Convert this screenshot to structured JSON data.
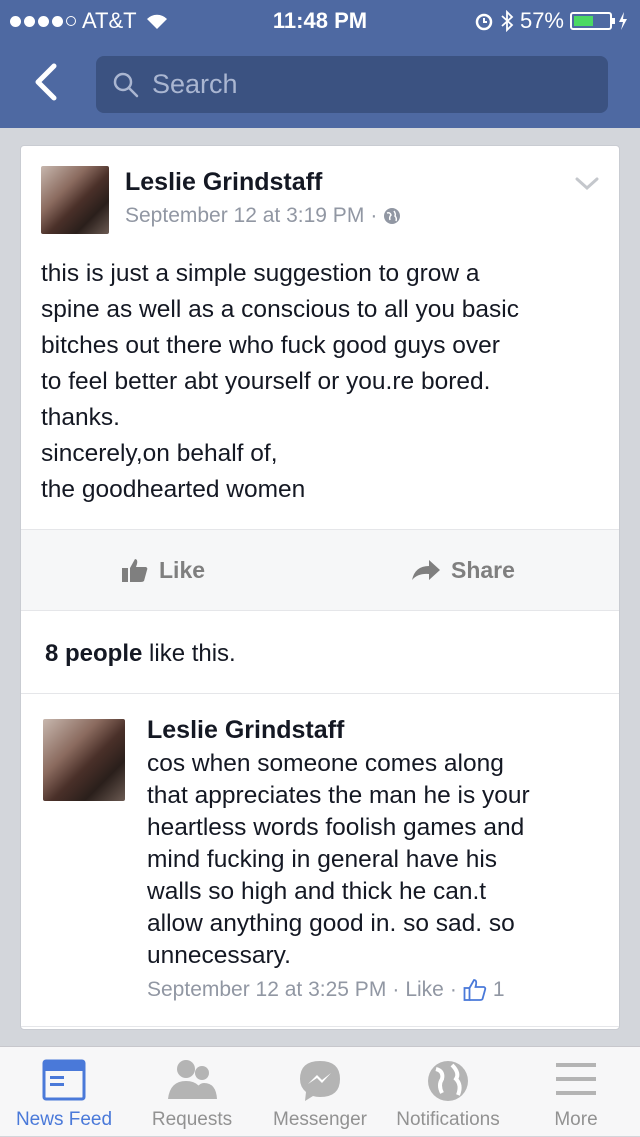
{
  "status_bar": {
    "carrier": "AT&T",
    "time": "11:48 PM",
    "battery_percent": "57%",
    "battery_level": 0.57,
    "signal_bars": 4
  },
  "nav": {
    "search_placeholder": "Search"
  },
  "post": {
    "author": "Leslie Grindstaff",
    "timestamp": "September 12 at 3:19 PM",
    "separator": "·",
    "text": "this is just a simple suggestion to grow a\nspine as well as a conscious to all you basic\nbitches out there who fuck good guys over\nto feel better abt yourself or you.re bored.\nthanks.\nsincerely,on behalf of,\nthe goodhearted women",
    "like_label": "Like",
    "share_label": "Share",
    "likes_count": "8 people",
    "likes_suffix": " like this."
  },
  "comment": {
    "author": "Leslie Grindstaff",
    "text": "cos when someone comes along\nthat appreciates the man he is your\nheartless words foolish games and\nmind fucking in general have his\nwalls so high and thick he can.t\nallow anything good in. so sad. so\nunnecessary.",
    "timestamp": "September 12 at 3:25 PM",
    "sep1": "·",
    "like_label": "Like",
    "sep2": "·",
    "like_count": "1"
  },
  "tabbar": {
    "tabs": [
      {
        "label": "News Feed",
        "icon": "news-feed-icon",
        "active": true
      },
      {
        "label": "Requests",
        "icon": "requests-icon",
        "active": false
      },
      {
        "label": "Messenger",
        "icon": "messenger-icon",
        "active": false
      },
      {
        "label": "Notifications",
        "icon": "globe-icon",
        "active": false
      },
      {
        "label": "More",
        "icon": "menu-icon",
        "active": false
      }
    ]
  },
  "colors": {
    "header": "#4e69a2",
    "search_bg": "#3b5281",
    "active_tab": "#4a79d9",
    "battery": "#4cd964"
  }
}
